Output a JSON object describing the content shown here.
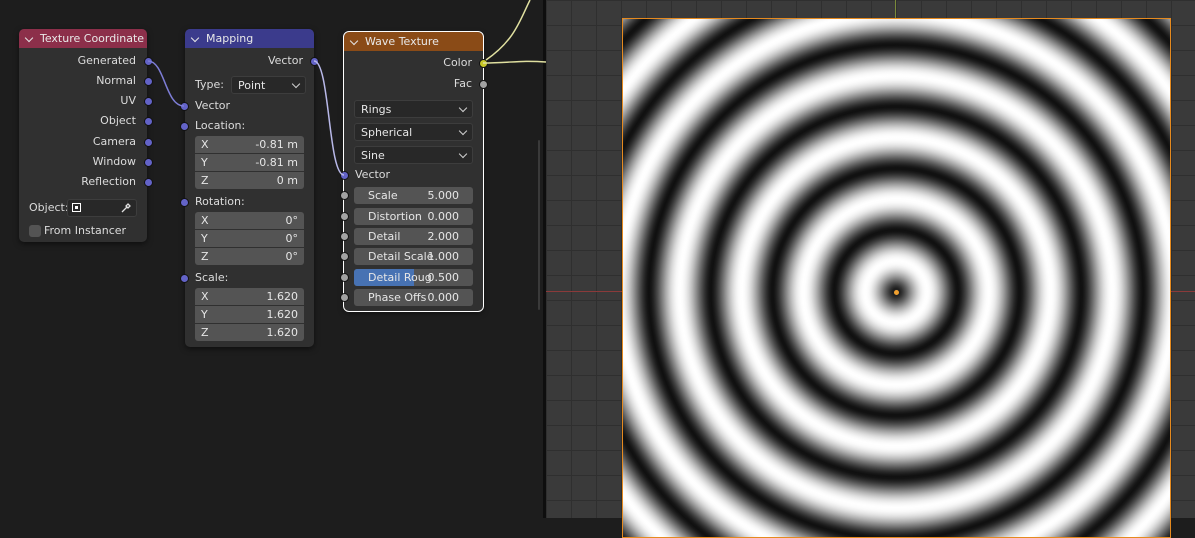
{
  "texture_coordinate": {
    "title": "Texture Coordinate",
    "header_color": "#8c2f4a",
    "outputs": [
      "Generated",
      "Normal",
      "UV",
      "Object",
      "Camera",
      "Window",
      "Reflection"
    ],
    "object_label": "Object:",
    "from_instancer_label": "From Instancer"
  },
  "mapping": {
    "title": "Mapping",
    "header_color": "#3b3b8c",
    "output_vector": "Vector",
    "type_label": "Type:",
    "type_value": "Point",
    "input_vector": "Vector",
    "location_label": "Location:",
    "location": [
      {
        "axis": "X",
        "value": "-0.81 m"
      },
      {
        "axis": "Y",
        "value": "-0.81 m"
      },
      {
        "axis": "Z",
        "value": "0 m"
      }
    ],
    "rotation_label": "Rotation:",
    "rotation": [
      {
        "axis": "X",
        "value": "0°"
      },
      {
        "axis": "Y",
        "value": "0°"
      },
      {
        "axis": "Z",
        "value": "0°"
      }
    ],
    "scale_label": "Scale:",
    "scale": [
      {
        "axis": "X",
        "value": "1.620"
      },
      {
        "axis": "Y",
        "value": "1.620"
      },
      {
        "axis": "Z",
        "value": "1.620"
      }
    ]
  },
  "wave_texture": {
    "title": "Wave Texture",
    "header_color": "#8a4b17",
    "output_color": "Color",
    "output_fac": "Fac",
    "wave_type": "Rings",
    "rings_direction": "Spherical",
    "profile": "Sine",
    "input_vector": "Vector",
    "inputs": [
      {
        "label": "Scale",
        "value": "5.000",
        "fill": 0
      },
      {
        "label": "Distortion",
        "value": "0.000",
        "fill": 0
      },
      {
        "label": "Detail",
        "value": "2.000",
        "fill": 0
      },
      {
        "label": "Detail Scale",
        "value": "1.000",
        "fill": 0
      },
      {
        "label": "Detail Roug",
        "value": "0.500",
        "fill": 0.5
      },
      {
        "label": "Phase Offs",
        "value": "0.000",
        "fill": 0
      }
    ]
  },
  "colors": {
    "vector_socket": "#6363c7",
    "color_socket": "#c7c729",
    "float_socket": "#a1a1a1",
    "selection": "#e58a1f",
    "slider_fill": "#4772b3"
  },
  "preview": {
    "pattern": "concentric rings",
    "ring_count": 9
  }
}
